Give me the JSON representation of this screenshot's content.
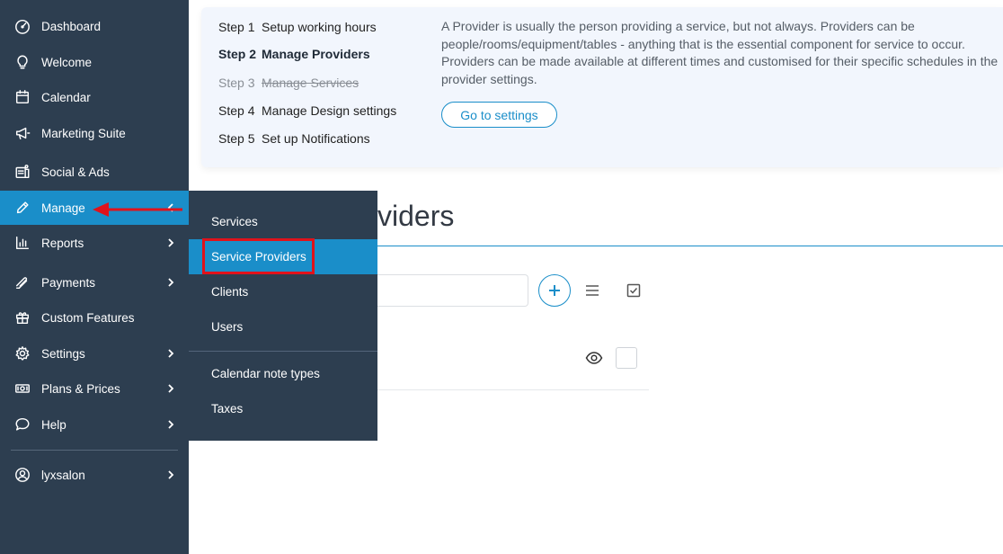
{
  "sidebar": {
    "items": [
      {
        "label": "Dashboard",
        "icon": "dashboard-icon"
      },
      {
        "label": "Welcome",
        "icon": "lightbulb-icon"
      },
      {
        "label": "Calendar",
        "icon": "calendar-icon"
      },
      {
        "label": "Marketing Suite",
        "icon": "megaphone-icon"
      },
      {
        "label": "Social & Ads",
        "icon": "social-icon"
      },
      {
        "label": "Manage",
        "icon": "pencil-icon"
      },
      {
        "label": "Reports",
        "icon": "bar-chart-icon"
      },
      {
        "label": "Payments",
        "icon": "payments-icon"
      },
      {
        "label": "Custom Features",
        "icon": "gift-icon"
      },
      {
        "label": "Settings",
        "icon": "gear-icon"
      },
      {
        "label": "Plans & Prices",
        "icon": "money-icon"
      },
      {
        "label": "Help",
        "icon": "chat-icon"
      }
    ],
    "user": {
      "label": "lyxsalon",
      "icon": "user-circle-icon"
    }
  },
  "submenu": {
    "items": [
      {
        "label": "Services"
      },
      {
        "label": "Service Providers"
      },
      {
        "label": "Clients"
      },
      {
        "label": "Users"
      },
      {
        "label": "Calendar note types"
      },
      {
        "label": "Taxes"
      }
    ]
  },
  "steps": [
    {
      "num": "Step 1",
      "label": "Setup working hours"
    },
    {
      "num": "Step 2",
      "label": "Manage Providers"
    },
    {
      "num": "Step 3",
      "label": "Manage Services"
    },
    {
      "num": "Step 4",
      "label": "Manage Design settings"
    },
    {
      "num": "Step 5",
      "label": "Set up Notifications"
    }
  ],
  "info": {
    "text": "A Provider is usually the person providing a service, but not always. Providers can be people/rooms/equipment/tables - anything that is the essential component for service to occur. Providers can be made available at different times and customised for their specific schedules in the provider settings.",
    "button": "Go to settings"
  },
  "page": {
    "title_visible": "viders"
  },
  "colors": {
    "sidebar_bg": "#2d3e50",
    "accent": "#1a8ec9",
    "annotation_red": "#e0121b"
  }
}
